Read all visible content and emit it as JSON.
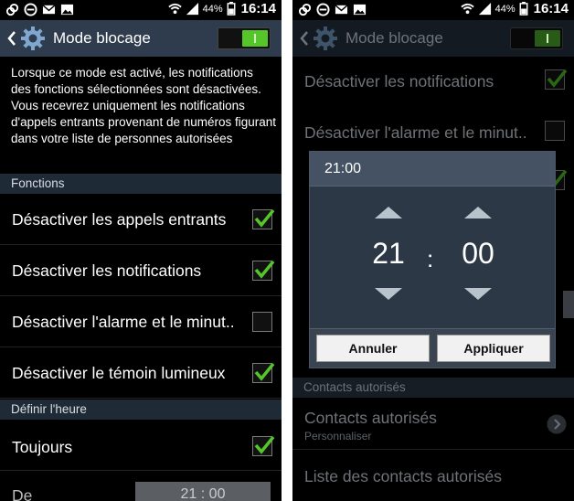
{
  "status": {
    "battery": "44%",
    "time": "16:14"
  },
  "left": {
    "title": "Mode blocage",
    "description": "Lorsque ce mode est activé, les notifications des fonctions sélectionnées sont désactivées. Vous recevrez uniquement les notifications d'appels entrants provenant de numéros figurant dans votre liste de personnes autorisées",
    "section_functions": "Fonctions",
    "items": [
      {
        "label": "Désactiver les appels entrants",
        "checked": true
      },
      {
        "label": "Désactiver les notifications",
        "checked": true
      },
      {
        "label": "Désactiver l'alarme et le minut..",
        "checked": false
      },
      {
        "label": "Désactiver le témoin lumineux",
        "checked": true
      }
    ],
    "section_time": "Définir l'heure",
    "always": {
      "label": "Toujours",
      "checked": true
    },
    "from_label": "De",
    "from_value": "21 : 00"
  },
  "right": {
    "title": "Mode blocage",
    "items": [
      {
        "label": "Désactiver les notifications"
      },
      {
        "label": "Désactiver l'alarme et le minut.."
      }
    ],
    "dialog": {
      "title": "21:00",
      "hours": "21",
      "separator": ":",
      "minutes": "00",
      "cancel": "Annuler",
      "apply": "Appliquer"
    },
    "section_contacts": "Contacts autorisés",
    "contacts_title": "Contacts autorisés",
    "contacts_sub": "Personnaliser",
    "contacts_list": "Liste des contacts autorisés"
  },
  "colors": {
    "accent_green": "#55c52a",
    "actionbar": "#2f3c4d",
    "section": "#1f2a37"
  }
}
